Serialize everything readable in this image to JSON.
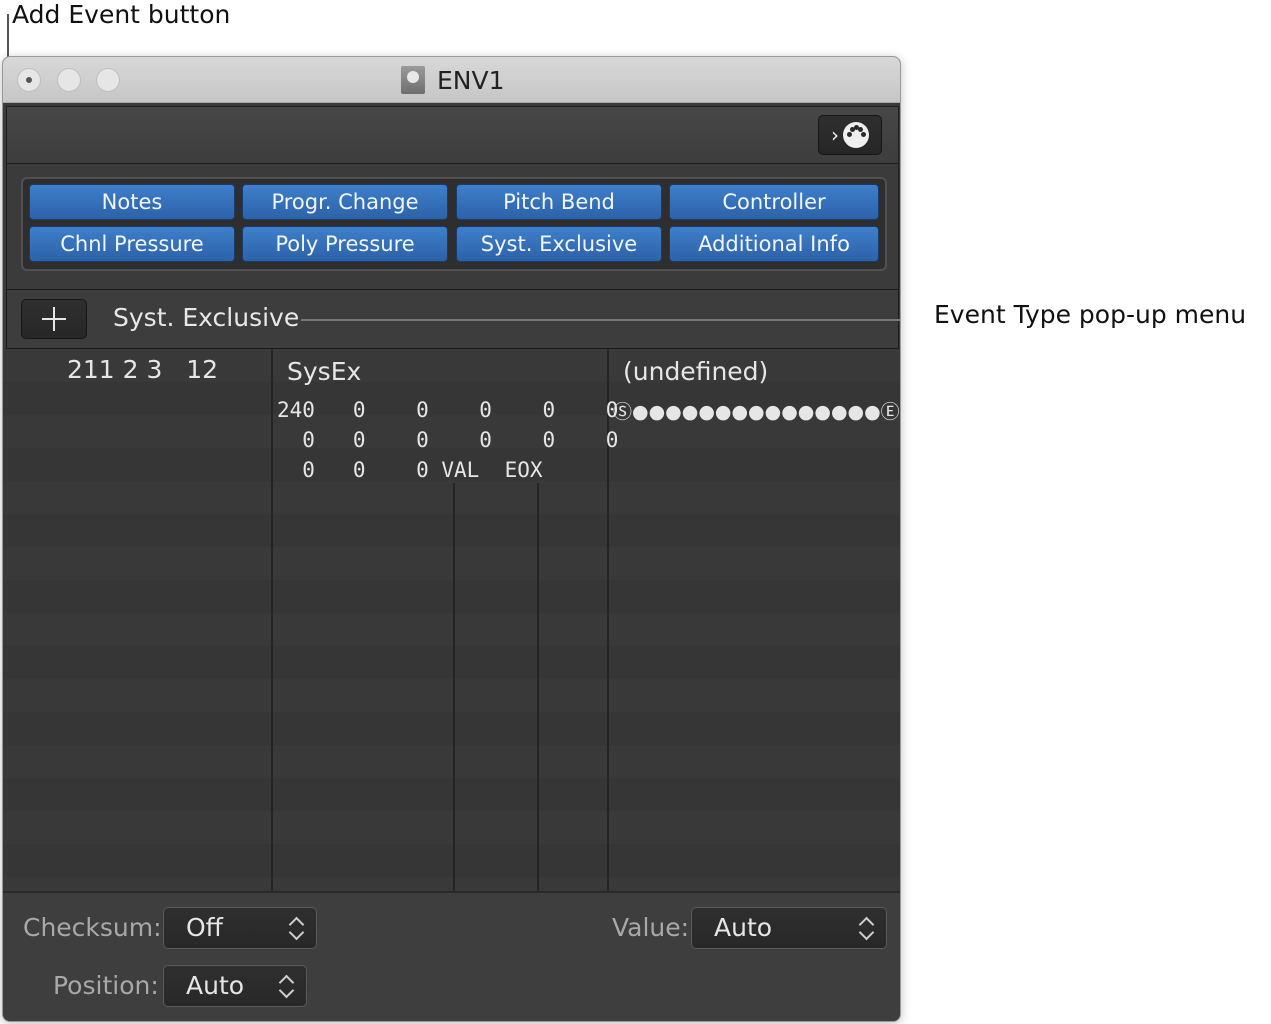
{
  "callouts": {
    "add_event": "Add Event button",
    "event_type": "Event Type pop-up menu"
  },
  "window": {
    "title": "ENV1"
  },
  "filters": {
    "row1": [
      "Notes",
      "Progr. Change",
      "Pitch Bend",
      "Controller"
    ],
    "row2": [
      "Chnl Pressure",
      "Poly Pressure",
      "Syst. Exclusive",
      "Additional Info"
    ]
  },
  "event_type": {
    "label": "Syst. Exclusive"
  },
  "event_row": {
    "position": "211 2 3   12",
    "status": "SysEx",
    "data_lines": [
      "240   0    0    0    0    0",
      "  0   0    0    0    0    0",
      "  0   0    0 VAL  EOX"
    ],
    "info": "(undefined)",
    "sysex_graphic": "Ⓢ●●●●●●●●●●●●●●●Ⓔ"
  },
  "bottom": {
    "checksum_label": "Checksum:",
    "checksum_value": "Off",
    "position_label": "Position:",
    "position_value": "Auto",
    "value_label": "Value:",
    "value_value": "Auto"
  }
}
